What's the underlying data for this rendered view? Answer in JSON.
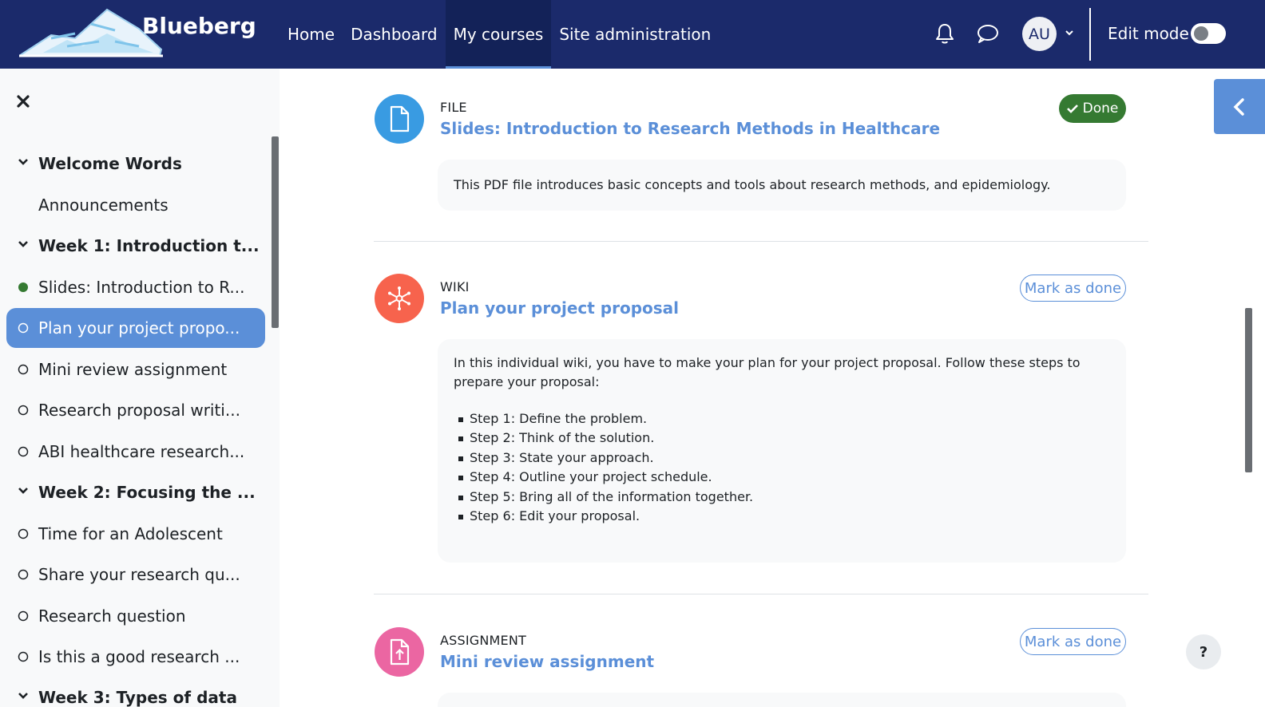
{
  "brand": {
    "name": "Blueberg"
  },
  "nav": {
    "items": [
      {
        "label": "Home"
      },
      {
        "label": "Dashboard"
      },
      {
        "label": "My courses"
      },
      {
        "label": "Site administration"
      }
    ],
    "active": "My courses"
  },
  "user": {
    "initials": "AU"
  },
  "edit_mode": {
    "label": "Edit mode",
    "enabled": false
  },
  "sidebar": {
    "items": [
      {
        "label": "Welcome Words",
        "kind": "section"
      },
      {
        "label": "Announcements",
        "kind": "activity"
      },
      {
        "label": "Week 1: Introduction t...",
        "kind": "section"
      },
      {
        "label": "Slides: Introduction to R...",
        "kind": "activity",
        "status": "complete"
      },
      {
        "label": "Plan your project propo...",
        "kind": "activity",
        "status": "incomplete",
        "selected": true
      },
      {
        "label": "Mini review assignment",
        "kind": "activity",
        "status": "incomplete"
      },
      {
        "label": "Research proposal writi...",
        "kind": "activity",
        "status": "incomplete"
      },
      {
        "label": "ABI healthcare research...",
        "kind": "activity",
        "status": "incomplete"
      },
      {
        "label": "Week 2: Focusing the ...",
        "kind": "section"
      },
      {
        "label": "Time for an Adolescent",
        "kind": "activity",
        "status": "incomplete"
      },
      {
        "label": "Share your research qu...",
        "kind": "activity",
        "status": "incomplete"
      },
      {
        "label": "Research question",
        "kind": "activity",
        "status": "incomplete"
      },
      {
        "label": "Is this a good research ...",
        "kind": "activity",
        "status": "incomplete"
      },
      {
        "label": "Week 3: Types of data",
        "kind": "section"
      }
    ]
  },
  "activities": [
    {
      "type": "FILE",
      "title": "Slides: Introduction to Research Methods in Healthcare",
      "completion": "Done",
      "description": "This PDF file introduces basic concepts and tools about  research methods, and epidemiology.",
      "icon": "file-icon",
      "color": "#399be2"
    },
    {
      "type": "WIKI",
      "title": "Plan your project proposal",
      "completion": "Mark as done",
      "description": "In this individual wiki, you have to make your plan for your project proposal. Follow these steps to prepare your proposal:",
      "steps": [
        "Step 1: Define the problem.",
        "Step 2: Think of the solution.",
        "Step 3: State your approach.",
        "Step 4: Outline your project schedule.",
        "Step 5: Bring all of the information together.",
        "Step 6: Edit your proposal."
      ],
      "icon": "wiki-icon",
      "color": "#f7634d"
    },
    {
      "type": "ASSIGNMENT",
      "title": "Mini review assignment",
      "completion": "Mark as done",
      "icon": "assignment-icon",
      "color": "#eb66a2"
    }
  ],
  "help": {
    "label": "?"
  },
  "colors": {
    "navbar": "#1b2a6b",
    "accent": "#5b8fd8",
    "done": "#357a32"
  }
}
